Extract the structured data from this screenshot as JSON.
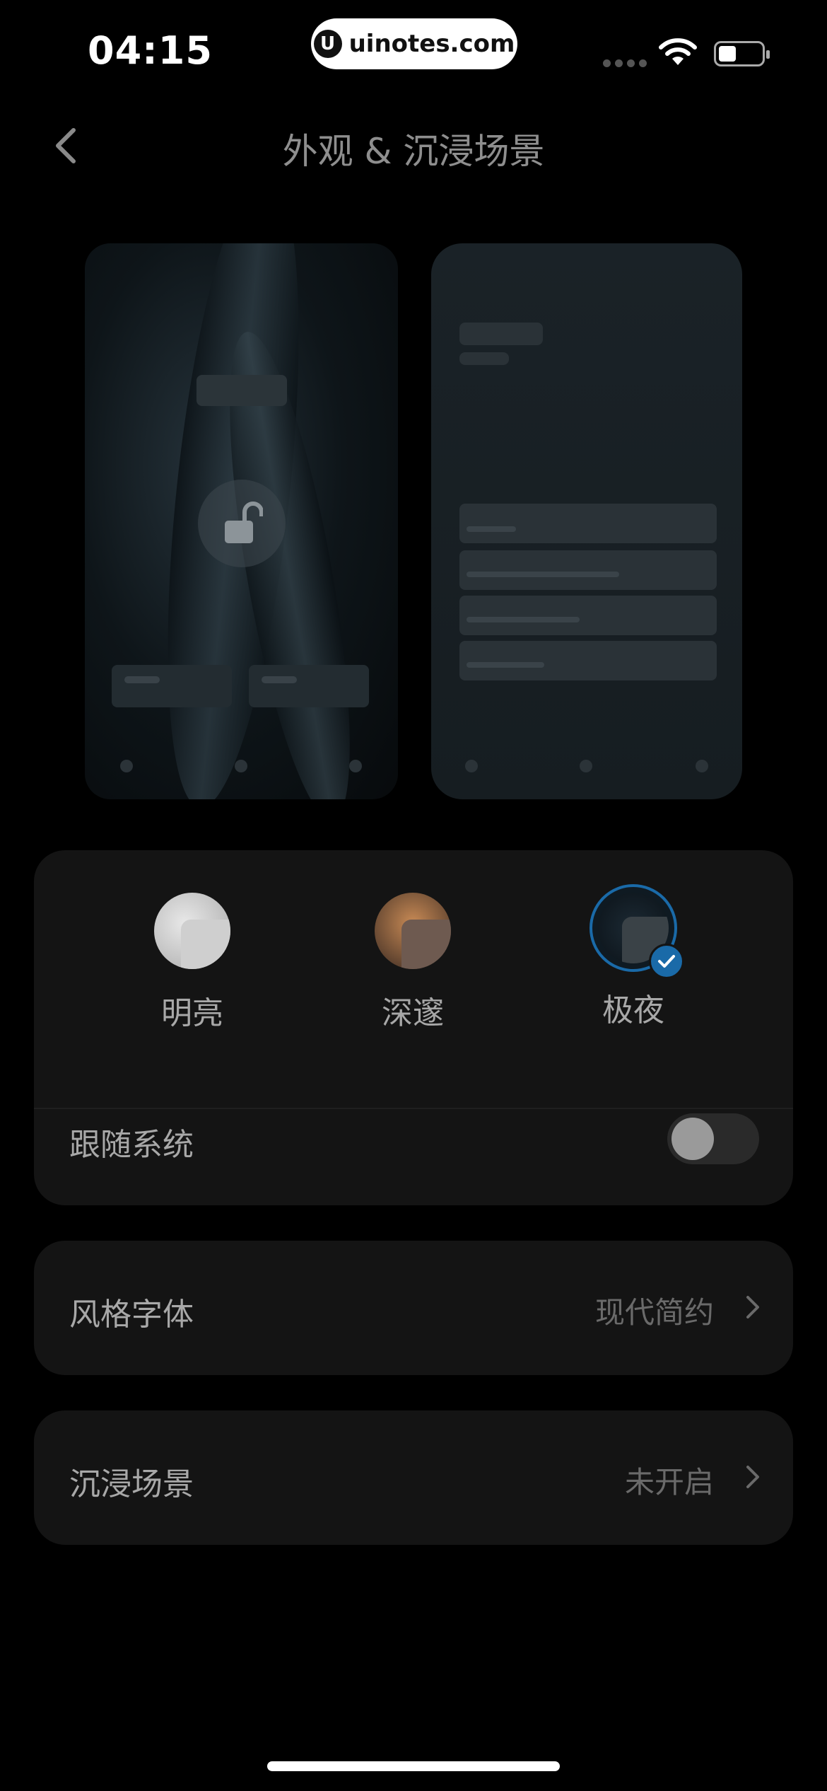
{
  "status_bar": {
    "time": "04:15",
    "site": "uinotes.com",
    "logo_letter": "U"
  },
  "header": {
    "title": "外观 & 沉浸场景"
  },
  "themes": [
    {
      "label": "明亮",
      "selected": false
    },
    {
      "label": "深邃",
      "selected": false
    },
    {
      "label": "极夜",
      "selected": true
    }
  ],
  "follow_system": {
    "label": "跟随系统",
    "enabled": false
  },
  "font_style": {
    "label": "风格字体",
    "value": "现代简约"
  },
  "immersive": {
    "label": "沉浸场景",
    "value": "未开启"
  },
  "colors": {
    "accent": "#1a6aa8",
    "background": "#000000",
    "card": "#141414"
  }
}
